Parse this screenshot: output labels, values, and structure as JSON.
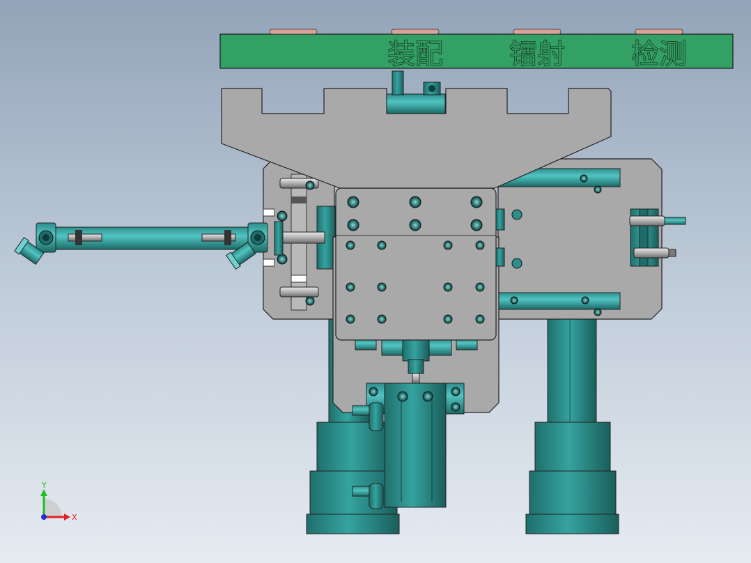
{
  "banner": {
    "labels": [
      "装配",
      "镭射",
      "检测"
    ],
    "color": "#33a163"
  },
  "triad": {
    "y_label": "Y",
    "x_label": "X",
    "y_color": "#1fbf1f",
    "x_color": "#e02020",
    "z_color": "#2030d0"
  },
  "colors": {
    "plate_gray": "#a9a9a9",
    "teal": "#2f8f8c",
    "teal_dark": "#1d6663",
    "outline": "#222222"
  },
  "icons": [
    "axis-triad-icon"
  ]
}
